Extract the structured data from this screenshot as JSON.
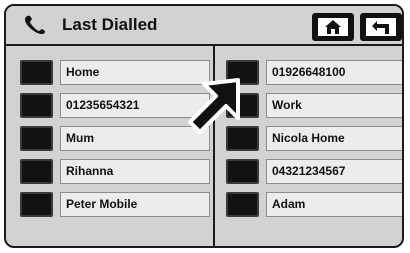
{
  "header": {
    "title": "Last  Dialled",
    "phone_icon": "phone-handset-icon",
    "home_icon": "home-icon",
    "back_icon": "return-arrow-icon"
  },
  "contacts": {
    "left": [
      {
        "label": "Home"
      },
      {
        "label": "01235654321"
      },
      {
        "label": "Mum"
      },
      {
        "label": "Rihanna"
      },
      {
        "label": "Peter Mobile"
      }
    ],
    "right": [
      {
        "label": "01926648100"
      },
      {
        "label": "Work"
      },
      {
        "label": "Nicola Home"
      },
      {
        "label": "04321234567"
      },
      {
        "label": "Adam"
      }
    ]
  },
  "pointer_icon": "pointer-arrow-icon"
}
